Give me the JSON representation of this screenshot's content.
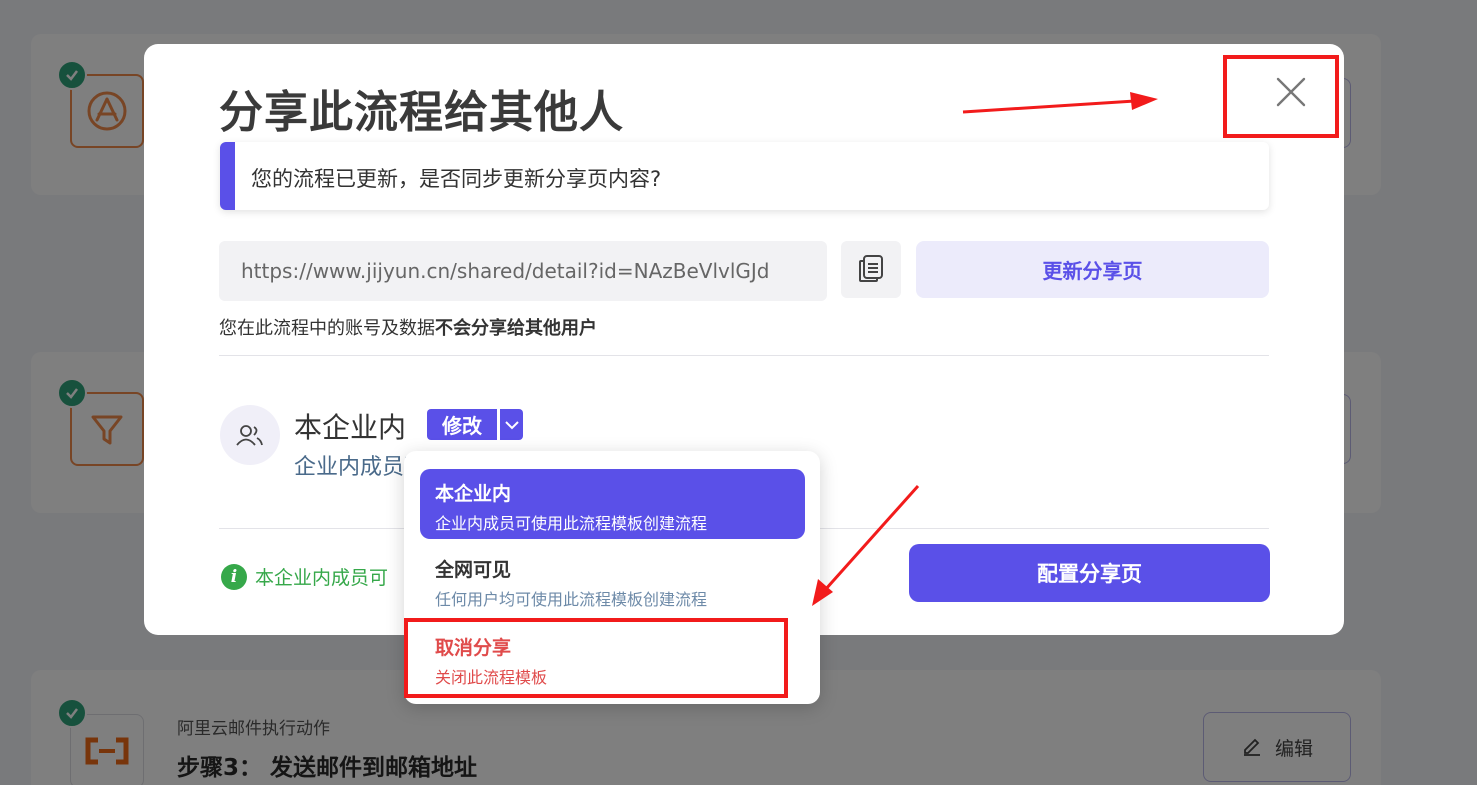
{
  "background": {
    "cards": [
      {
        "subtitle": "",
        "title": "",
        "edit_label": ""
      },
      {
        "subtitle": "",
        "title": "",
        "edit_label": ""
      },
      {
        "subtitle": "阿里云邮件执行动作",
        "title": "步骤3： 发送邮件到邮箱地址",
        "edit_label": "编辑"
      }
    ]
  },
  "modal": {
    "title": "分享此流程给其他人",
    "notice": "您的流程已更新，是否同步更新分享页内容?",
    "share_url": "https://www.jijyun.cn/shared/detail?id=NAzBeVlvlGJd",
    "update_button": "更新分享页",
    "privacy_prefix": "您在此流程中的账号及数据",
    "privacy_bold": "不会分享给其他用户",
    "scope": {
      "title": "本企业内",
      "modify_label": "修改",
      "desc": "企业内成员可使用此流程模板创建流程"
    },
    "info_text": "本企业内成员可",
    "config_button": "配置分享页"
  },
  "dropdown": {
    "items": [
      {
        "label": "本企业内",
        "desc": "企业内成员可使用此流程模板创建流程"
      },
      {
        "label": "全网可见",
        "desc": "任何用户均可使用此流程模板创建流程"
      },
      {
        "label": "取消分享",
        "desc": "关闭此流程模板"
      }
    ]
  },
  "colors": {
    "accent": "#5a50e8",
    "danger": "#e04b4b",
    "success": "#36a84a",
    "annotation": "#f21b1b"
  },
  "icons": [
    "app-store-icon",
    "filter-icon",
    "aliyun-logo-icon",
    "check-icon",
    "pencil-icon",
    "close-icon",
    "copy-icon",
    "users-icon",
    "chevron-down-icon",
    "info-icon"
  ]
}
